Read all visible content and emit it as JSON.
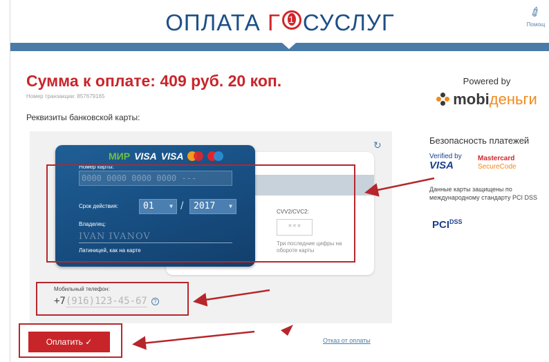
{
  "header": {
    "logo_part1": "ОПЛАТА ",
    "logo_part2": "Г",
    "logo_part3": "СУСЛУГ",
    "help_label": "Помощ",
    "help_icon": "paperclip-icon"
  },
  "payment": {
    "amount_text": "Сумма к оплате:  409 руб. 20 коп.",
    "transaction": "Номер транзакции: 857679165",
    "requisites_label": "Реквизиты банковской карты:"
  },
  "card": {
    "brand_mir": "МИР",
    "brand_visa": "VISA",
    "brand_visa_electron": "VISA",
    "number_label": "Номер карты:",
    "number_placeholder": "0000 0000 0000 0000 ---",
    "expiry_label": "Срок действия:",
    "expiry_month": "01",
    "expiry_year": "2017",
    "holder_label": "Владелец:",
    "holder_placeholder": "IVAN IVANOV",
    "holder_hint": "Латиницей, как на карте",
    "cvv_label": "CVV2/CVC2:",
    "cvv_placeholder": "***",
    "cvv_hint": "Три последние цифры на обороте карты",
    "refresh_icon": "refresh-icon"
  },
  "phone": {
    "label": "Мобильный телефон:",
    "prefix": "+7",
    "placeholder": "(916)123-45-67",
    "help_icon": "question-icon"
  },
  "actions": {
    "pay_label": "Оплатить ✓",
    "cancel_label": "Отказ от оплаты"
  },
  "sidebar": {
    "powered_by": "Powered by",
    "mobi_part1": "mobi",
    "mobi_part2": "деньги",
    "security_title": "Безопасность платежей",
    "verified_by": "Verified by",
    "verified_visa": "VISA",
    "mc_line1": "Mastercard",
    "mc_line2": "SecureCode",
    "security_note": "Данные карты защищены по международному стандарту PCI DSS",
    "pci": "PCI",
    "dss": "DSS"
  },
  "colors": {
    "brand_blue": "#1e4f86",
    "accent_red": "#c8252a",
    "band_blue": "#4a7ba7",
    "card_blue": "#174d80",
    "annotation_red": "#b6262b"
  }
}
